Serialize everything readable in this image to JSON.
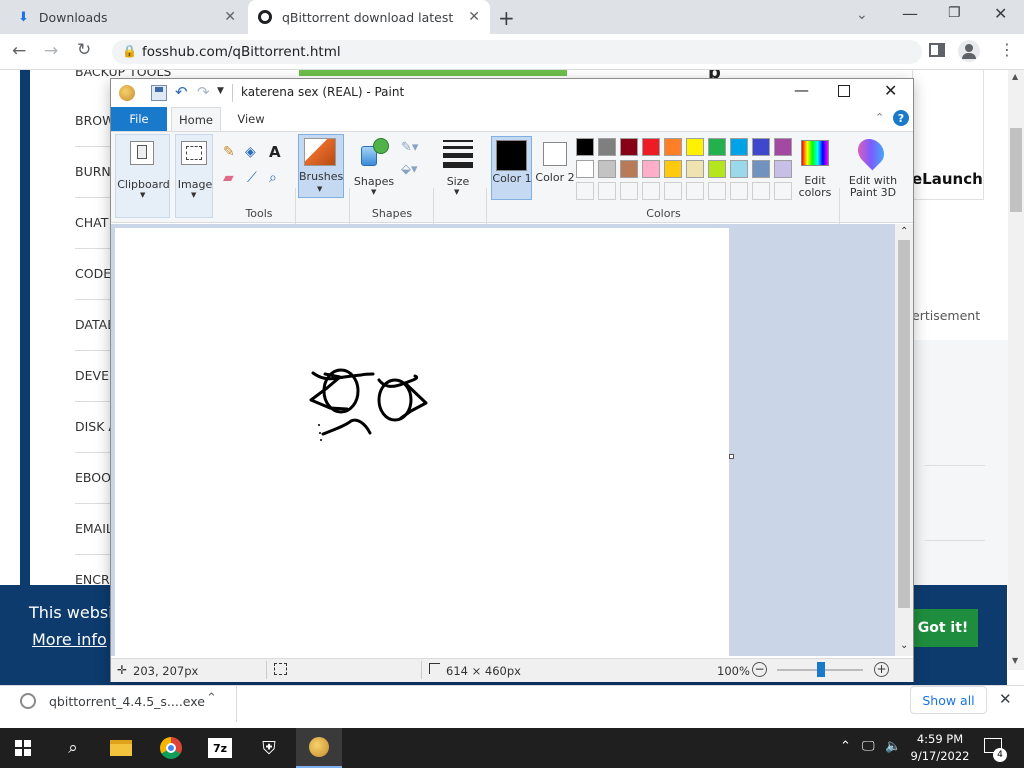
{
  "browser": {
    "tabs": [
      {
        "label": "Downloads",
        "icon": "download-icon"
      },
      {
        "label": "qBittorrent download latest versi",
        "icon": "site-icon"
      }
    ],
    "url": "fosshub.com/qBittorrent.html",
    "window_controls": [
      "minimize",
      "restore",
      "close"
    ]
  },
  "page": {
    "menu_items": [
      "BACKUP TOOLS",
      "BROW",
      "BURN",
      "CHAT",
      "CODE",
      "DATAE",
      "DEVEL",
      "DISK A",
      "EBOO",
      "EMAIL",
      "ENCR"
    ],
    "right_text": "eLaunch",
    "advert_text": "ertisement",
    "cookie_text": "This websit",
    "cookie_more": "More info",
    "got_it": "Got it!"
  },
  "paint": {
    "title": "katerena sex (REAL) - Paint",
    "tabs": {
      "file": "File",
      "home": "Home",
      "view": "View"
    },
    "ribbon": {
      "clipboard": "Clipboard",
      "image": "Image",
      "tools_group": "Tools",
      "brushes": "Brushes",
      "shapes": "Shapes",
      "shapes_group": "Shapes",
      "size": "Size",
      "color1": "Color 1",
      "color2": "Color 2",
      "colors_group": "Colors",
      "edit_colors": "Edit colors",
      "edit_paint3d": "Edit with Paint 3D"
    },
    "palette_row1": [
      "#000000",
      "#7f7f7f",
      "#880015",
      "#ed1c24",
      "#ff7f27",
      "#fff200",
      "#22b14c",
      "#00a2e8",
      "#3f48cc",
      "#a349a4"
    ],
    "palette_row2": [
      "#ffffff",
      "#c3c3c3",
      "#b97a57",
      "#ffaec9",
      "#ffc90e",
      "#efe4b0",
      "#b5e61d",
      "#99d9ea",
      "#7092be",
      "#c8bfe7"
    ],
    "status": {
      "cursor_pos": "203, 207px",
      "canvas_size": "614 × 460px",
      "zoom": "100%"
    }
  },
  "download_bar": {
    "filename": "qbittorrent_4.4.5_s....exe",
    "show_all": "Show all"
  },
  "taskbar": {
    "time": "4:59 PM",
    "date": "9/17/2022",
    "notification_count": "4"
  }
}
